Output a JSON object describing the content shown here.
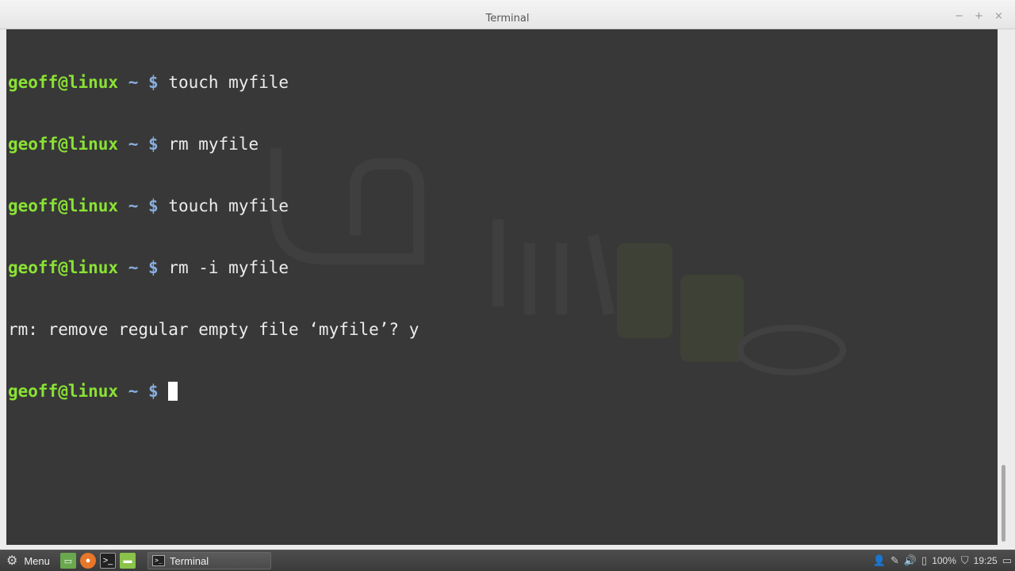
{
  "window": {
    "title": "Terminal",
    "controls": {
      "minimize": "−",
      "maximize": "+",
      "close": "×"
    }
  },
  "terminal": {
    "lines": [
      {
        "user": "geoff@linux",
        "path": "~ $",
        "cmd": " touch myfile"
      },
      {
        "user": "geoff@linux",
        "path": "~ $",
        "cmd": " rm myfile"
      },
      {
        "user": "geoff@linux",
        "path": "~ $",
        "cmd": " touch myfile"
      },
      {
        "user": "geoff@linux",
        "path": "~ $",
        "cmd": " rm -i myfile"
      },
      {
        "output": "rm: remove regular empty file ‘myfile’? y"
      },
      {
        "user": "geoff@linux",
        "path": "~ $",
        "cmd": " "
      }
    ]
  },
  "panel": {
    "menu_label": "Menu",
    "launchers": [
      {
        "icon": "show-desktop-icon",
        "color": "#6aa84f"
      },
      {
        "icon": "firefox-icon",
        "color": "#e8762b"
      },
      {
        "icon": "terminal-icon",
        "color": "#222222"
      },
      {
        "icon": "files-icon",
        "color": "#8bc34a"
      }
    ],
    "task_label": "Terminal",
    "battery": "100%",
    "clock": "19:25"
  }
}
